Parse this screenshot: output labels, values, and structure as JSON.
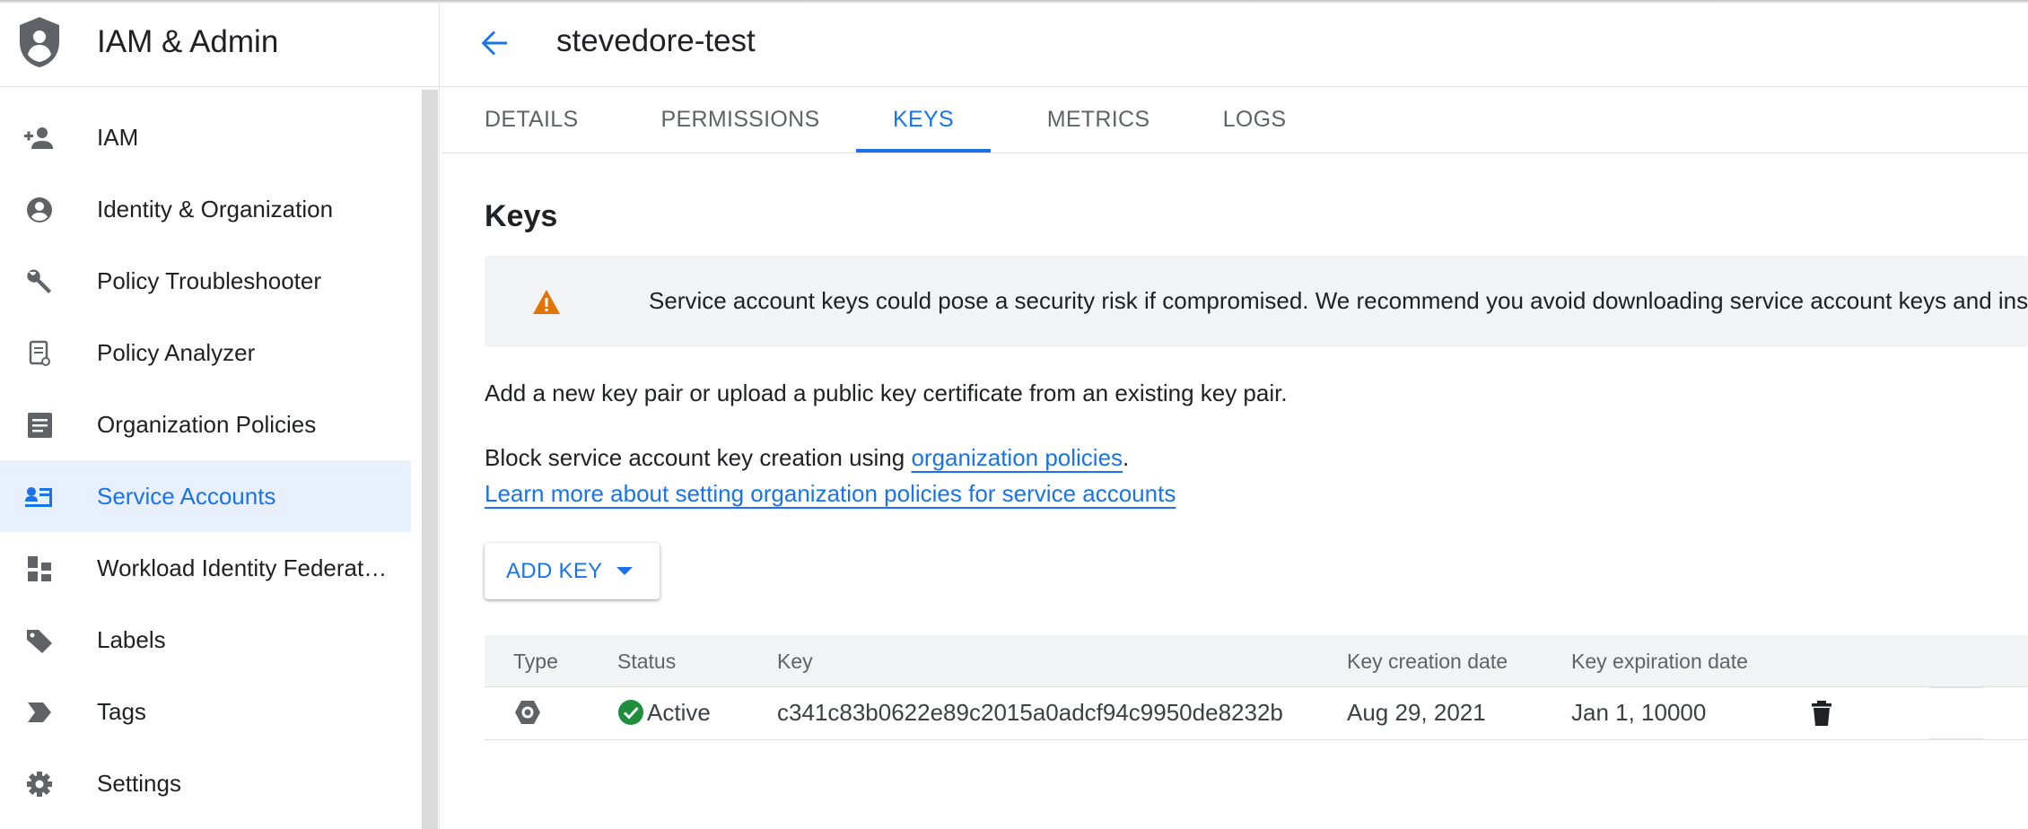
{
  "app": {
    "title": "IAM & Admin",
    "icon": "shield-person-icon"
  },
  "sidebar": {
    "items": [
      {
        "label": "IAM",
        "icon": "person-add-icon",
        "active": false
      },
      {
        "label": "Identity & Organization",
        "icon": "account-circle-icon",
        "active": false
      },
      {
        "label": "Policy Troubleshooter",
        "icon": "wrench-icon",
        "active": false
      },
      {
        "label": "Policy Analyzer",
        "icon": "policy-document-icon",
        "active": false
      },
      {
        "label": "Organization Policies",
        "icon": "article-icon",
        "active": false
      },
      {
        "label": "Service Accounts",
        "icon": "service-account-icon",
        "active": true
      },
      {
        "label": "Workload Identity Federat…",
        "icon": "workload-identity-icon",
        "active": false
      },
      {
        "label": "Labels",
        "icon": "tag-icon",
        "active": false
      },
      {
        "label": "Tags",
        "icon": "label-arrow-icon",
        "active": false
      },
      {
        "label": "Settings",
        "icon": "gear-icon",
        "active": false
      }
    ]
  },
  "header": {
    "resource_name": "stevedore-test"
  },
  "tabs": [
    {
      "label": "DETAILS",
      "active": false
    },
    {
      "label": "PERMISSIONS",
      "active": false
    },
    {
      "label": "KEYS",
      "active": true
    },
    {
      "label": "METRICS",
      "active": false
    },
    {
      "label": "LOGS",
      "active": false
    }
  ],
  "keys_section": {
    "title": "Keys",
    "warning": "Service account keys could pose a security risk if compromised. We recommend you avoid downloading service account keys and instead",
    "description": "Add a new key pair or upload a public key certificate from an existing key pair.",
    "block_text": "Block service account key creation using ",
    "block_link": "organization policies",
    "block_suffix": ".",
    "learn_more_link": "Learn more about setting organization policies for service accounts",
    "add_key_label": "ADD KEY"
  },
  "table": {
    "headers": [
      "Type",
      "Status",
      "Key",
      "Key creation date",
      "Key expiration date"
    ],
    "rows": [
      {
        "type_icon": "hexagon-settings-icon",
        "status": "Active",
        "key": "c341c83b0622e89c2015a0adcf94c9950de8232b",
        "created": "Aug 29, 2021",
        "expires": "Jan 1, 10000"
      }
    ]
  },
  "colors": {
    "accent": "#1a73e8",
    "active_bg": "#e8f0fe",
    "warning": "#e37400",
    "success": "#1e8e3e"
  }
}
